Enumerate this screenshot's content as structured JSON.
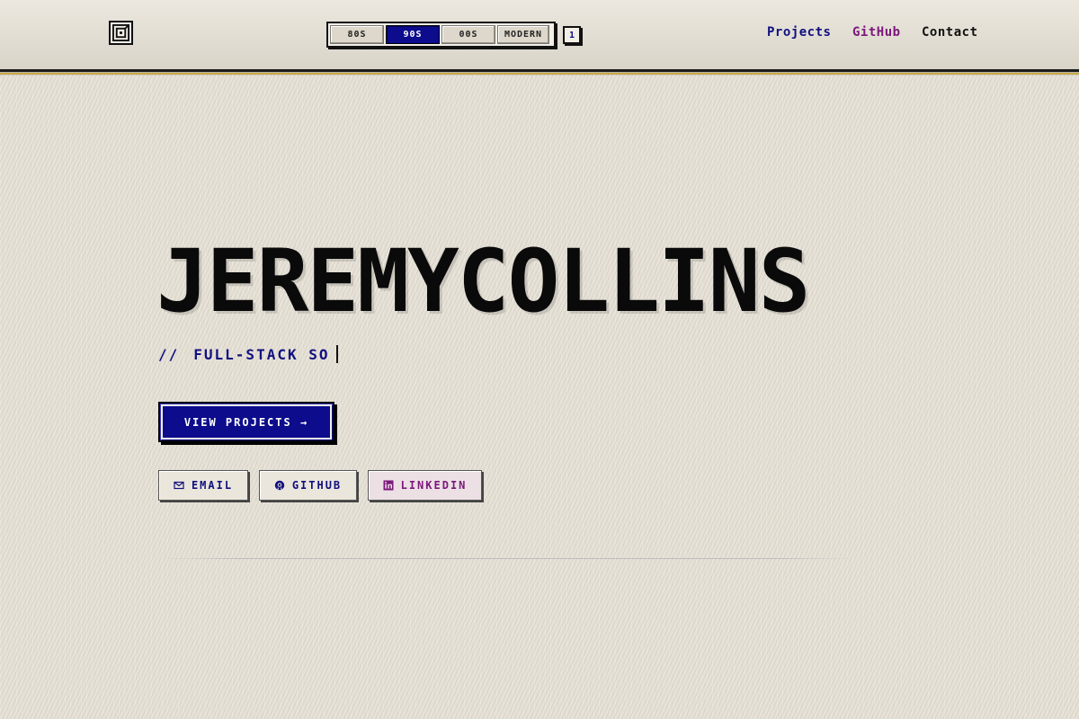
{
  "header": {
    "eras": [
      {
        "label": "80S",
        "active": false
      },
      {
        "label": "90S",
        "active": true
      },
      {
        "label": "00S",
        "active": false
      },
      {
        "label": "MODERN",
        "active": false
      }
    ],
    "counter": "1",
    "nav": {
      "projects": "Projects",
      "github": "GitHub",
      "contact": "Contact"
    }
  },
  "hero": {
    "name": "JEREMYCOLLINS",
    "tagline_prefix": "//",
    "tagline_text": "FULL-STACK SO",
    "cta_label": "VIEW PROJECTS →",
    "social": {
      "email": "EMAIL",
      "github": "GITHUB",
      "linkedin": "LINKEDIN"
    }
  },
  "colors": {
    "accent_blue": "#0c0c8c",
    "accent_purple": "#7c187c",
    "background": "#e6e1d6"
  }
}
